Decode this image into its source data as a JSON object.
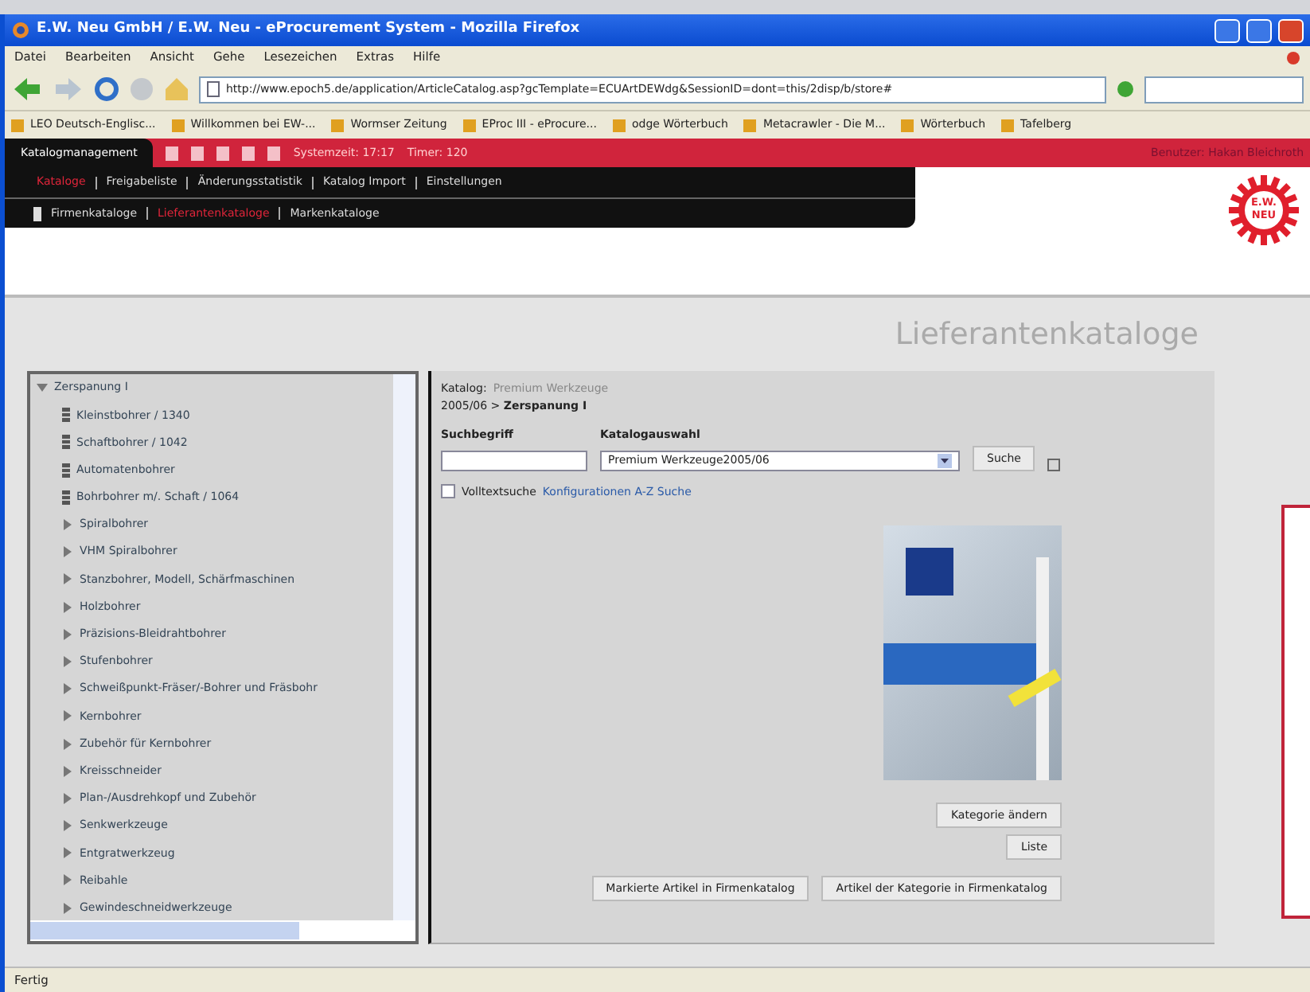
{
  "window": {
    "title": "E.W. Neu GmbH / E.W. Neu - eProcurement System - Mozilla Firefox"
  },
  "menu_bar": [
    "Datei",
    "Bearbeiten",
    "Ansicht",
    "Gehe",
    "Lesezeichen",
    "Extras",
    "Hilfe"
  ],
  "address_bar": {
    "url": "http://www.epoch5.de/application/ArticleCatalog.asp?gcTemplate=ECUArtDEWdg&SessionID=dont=this/2disp/b/store#"
  },
  "bookmarks": [
    "LEO Deutsch-Englisc...",
    "Willkommen bei EW-...",
    "Wormser Zeitung",
    "EProc III - eProcure...",
    "odge Wörterbuch",
    "Metacrawler - Die M...",
    "Wörterbuch",
    "Tafelberg"
  ],
  "app_bar": {
    "title": "Katalogmanagement",
    "system_time": "Systemzeit: 17:17",
    "timer": "Timer: 120",
    "user": "Benutzer: Hakan Bleichroth"
  },
  "main_menu": [
    {
      "label": "Kataloge",
      "selected": true
    },
    {
      "label": "Freigabeliste",
      "selected": false
    },
    {
      "label": "Änderungsstatistik",
      "selected": false
    },
    {
      "label": "Katalog Import",
      "selected": false
    },
    {
      "label": "Einstellungen",
      "selected": false
    }
  ],
  "sub_menu": [
    {
      "label": "Firmenkataloge",
      "selected": false
    },
    {
      "label": "Lieferantenkataloge",
      "selected": true
    },
    {
      "label": "Markenkataloge",
      "selected": false
    }
  ],
  "logo": {
    "text": "E.W. NEU"
  },
  "page_title": "Lieferantenkataloge",
  "tree": {
    "label": "Zerspanung I",
    "expanded": true,
    "children": [
      {
        "label": "Kleinstbohrer / 1340",
        "kind": "document"
      },
      {
        "label": "Schaftbohrer / 1042",
        "kind": "document"
      },
      {
        "label": "Automatenbohrer",
        "kind": "document"
      },
      {
        "label": "Bohrbohrer m/. Schaft / 1064",
        "kind": "document"
      },
      {
        "label": "Spiralbohrer",
        "kind": "folder"
      },
      {
        "label": "VHM Spiralbohrer",
        "kind": "folder"
      },
      {
        "label": "Stanzbohrer, Modell, Schärfmaschinen",
        "kind": "folder"
      },
      {
        "label": "Holzbohrer",
        "kind": "folder"
      },
      {
        "label": "Präzisions-Bleidrahtbohrer",
        "kind": "folder"
      },
      {
        "label": "Stufenbohrer",
        "kind": "folder"
      },
      {
        "label": "Schweißpunkt-Fräser/-Bohrer und Fräsbohr",
        "kind": "folder"
      },
      {
        "label": "Kernbohrer",
        "kind": "folder"
      },
      {
        "label": "Zubehör für Kernbohrer",
        "kind": "folder"
      },
      {
        "label": "Kreisschneider",
        "kind": "folder"
      },
      {
        "label": "Plan-/Ausdrehkopf und Zubehör",
        "kind": "folder"
      },
      {
        "label": "Senkwerkzeuge",
        "kind": "folder"
      },
      {
        "label": "Entgratwerkzeug",
        "kind": "folder"
      },
      {
        "label": "Reibahle",
        "kind": "folder"
      },
      {
        "label": "Gewindeschneidwerkzeuge",
        "kind": "folder"
      }
    ]
  },
  "catalog": {
    "label": "Katalog:",
    "name": "Premium Werkzeuge",
    "path": "2005/06 > **Zerspanung I**"
  },
  "search": {
    "term_label": "Suchbegriff",
    "selection_label": "Katalogauswahl",
    "selection_value": "Premium Werkzeuge2005/06",
    "button": "Suche"
  },
  "fulltext": {
    "label": "Volltextsuche",
    "checked": false,
    "link": "Konfigurationen A-Z Suche"
  },
  "buttons": {
    "change_category": "Kategorie ändern",
    "list": "Liste",
    "marked_to_company": "Markierte Artikel in Firmenkatalog",
    "category_to_company": "Artikel der Kategorie in Firmenkatalog"
  },
  "status_bar": "Fertig"
}
